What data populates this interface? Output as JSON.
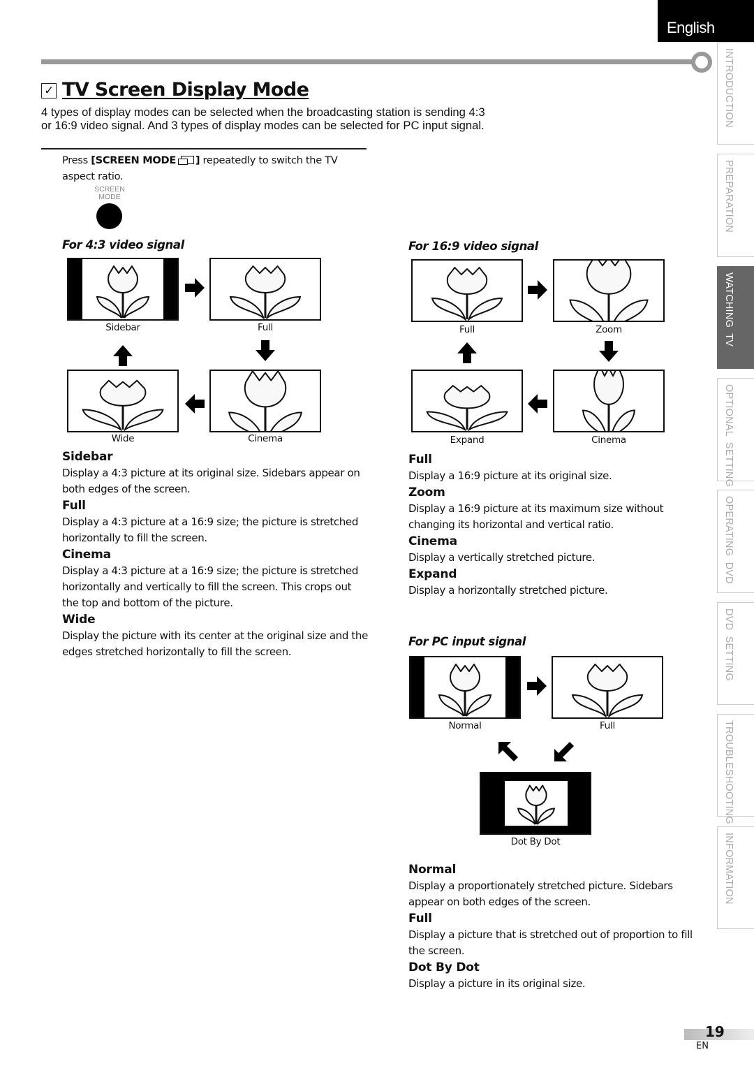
{
  "header": {
    "language": "English",
    "title": "TV Screen Display Mode",
    "title_icon": "checkbox-icon",
    "intro": "4 types of display modes can be selected when the broadcasting station is sending 4:3 or 16:9 video signal. And 3 types of display modes can be selected for PC input signal.",
    "press_prefix": "Press ",
    "press_key": "[SCREEN MODE ",
    "press_key_close": "]",
    "press_suffix": " repeatedly to switch the TV aspect ratio.",
    "button_label_line1": "SCREEN",
    "button_label_line2": "MODE"
  },
  "side_tabs": [
    {
      "label": "INTRODUCTION",
      "active": false
    },
    {
      "label": "PREPARATION",
      "active": false
    },
    {
      "label": "WATCHING  TV",
      "active": true
    },
    {
      "label": "OPTIONAL  SETTING",
      "active": false
    },
    {
      "label": "OPERATING  DVD",
      "active": false
    },
    {
      "label": "DVD  SETTING",
      "active": false
    },
    {
      "label": "TROUBLESHOOTING",
      "active": false
    },
    {
      "label": "INFORMATION",
      "active": false
    }
  ],
  "signal_43": {
    "title": "For 4:3 video signal",
    "modes": [
      "Sidebar",
      "Full",
      "Wide",
      "Cinema"
    ],
    "descriptions": [
      {
        "name": "Sidebar",
        "text": "Display a 4:3 picture at its original size. Sidebars appear on both edges of the screen."
      },
      {
        "name": "Full",
        "text": "Display a 4:3 picture at a 16:9 size; the picture is stretched horizontally to fill the screen."
      },
      {
        "name": "Cinema",
        "text": "Display a 4:3 picture at a 16:9 size; the picture is stretched horizontally and vertically to fill the screen. This crops out the top and bottom of the picture."
      },
      {
        "name": "Wide",
        "text": "Display the picture with its center at the original size and the edges stretched horizontally to fill the screen."
      }
    ]
  },
  "signal_169": {
    "title": "For 16:9 video signal",
    "modes": [
      "Full",
      "Zoom",
      "Expand",
      "Cinema"
    ],
    "descriptions": [
      {
        "name": "Full",
        "text": "Display a 16:9 picture at its original size."
      },
      {
        "name": "Zoom",
        "text": "Display a 16:9 picture at its maximum size without changing its horizontal and vertical ratio."
      },
      {
        "name": "Cinema",
        "text": "Display a vertically stretched picture."
      },
      {
        "name": "Expand",
        "text": "Display a horizontally stretched picture."
      }
    ]
  },
  "signal_pc": {
    "title": "For PC input signal",
    "modes": [
      "Normal",
      "Full",
      "Dot By Dot"
    ],
    "descriptions": [
      {
        "name": "Normal",
        "text": "Display a proportionately stretched picture. Sidebars appear on both edges of the screen."
      },
      {
        "name": "Full",
        "text": "Display a picture that is stretched out of proportion to fill the screen."
      },
      {
        "name": "Dot By Dot",
        "text": "Display a picture in its original size."
      }
    ]
  },
  "footer": {
    "page_number": "19",
    "locale": "EN"
  }
}
